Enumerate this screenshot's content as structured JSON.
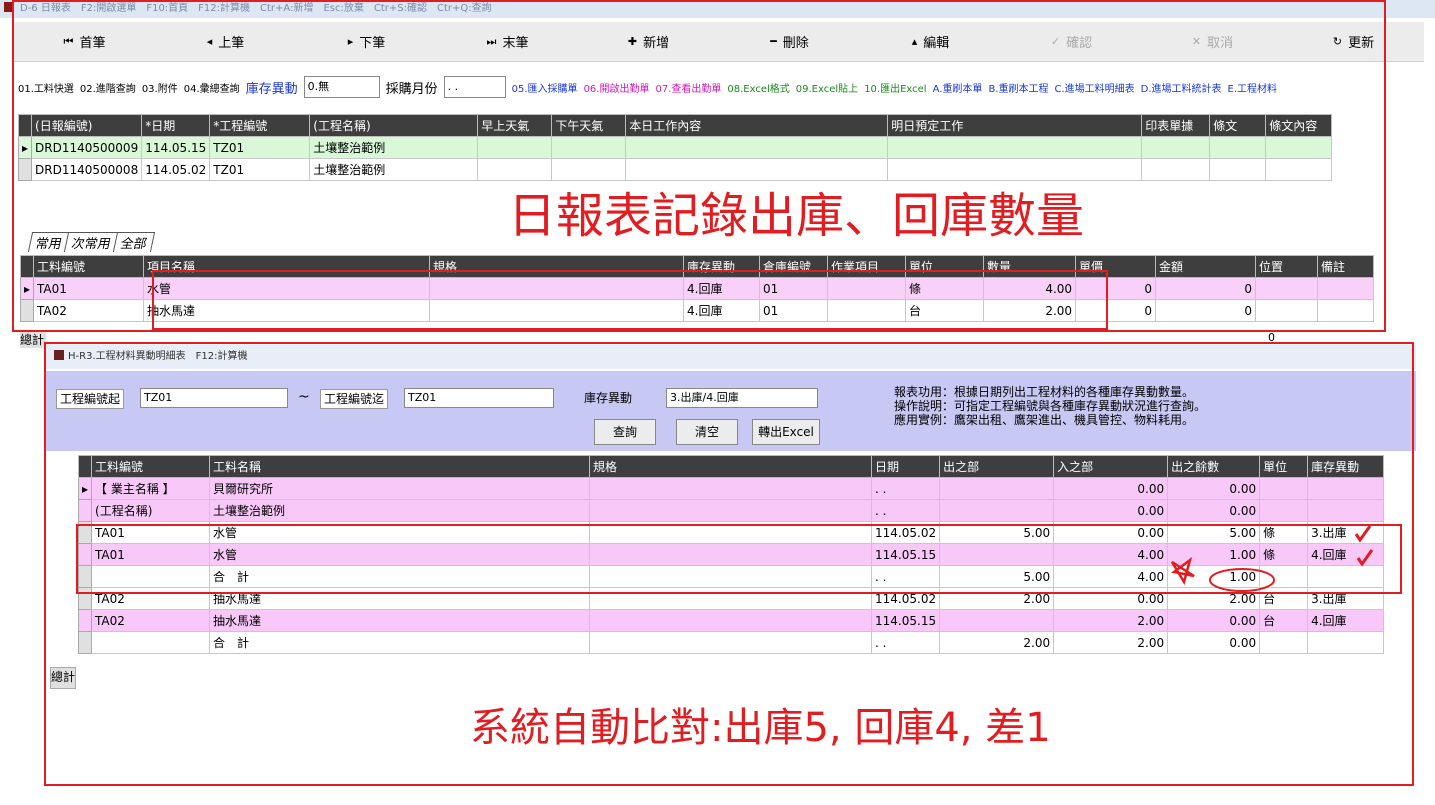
{
  "window": {
    "title": "D-6 日報表　F2:開啟選單　F10:首頁　F12:計算機　Ctr+A:新增　Esc:放棄　Ctr+S:確認　Ctr+Q:查詢"
  },
  "toolbar": [
    {
      "icon": "first-icon",
      "glyph": "⏮",
      "label": "首筆",
      "enabled": true
    },
    {
      "icon": "prev-icon",
      "glyph": "◂",
      "label": "上筆",
      "enabled": true
    },
    {
      "icon": "next-icon",
      "glyph": "▸",
      "label": "下筆",
      "enabled": true
    },
    {
      "icon": "last-icon",
      "glyph": "⏭",
      "label": "末筆",
      "enabled": true
    },
    {
      "icon": "plus-icon",
      "glyph": "✚",
      "label": "新增",
      "enabled": true
    },
    {
      "icon": "minus-icon",
      "glyph": "━",
      "label": "刪除",
      "enabled": true
    },
    {
      "icon": "up-icon",
      "glyph": "▴",
      "label": "編輯",
      "enabled": true
    },
    {
      "icon": "check-icon",
      "glyph": "✓",
      "label": "確認",
      "enabled": false
    },
    {
      "icon": "close-icon",
      "glyph": "✕",
      "label": "取消",
      "enabled": false
    },
    {
      "icon": "refresh-icon",
      "glyph": "↻",
      "label": "更新",
      "enabled": true
    }
  ],
  "query": {
    "links": [
      "01.工料快選",
      "02.進階查詢",
      "03.附件",
      "04.彙總查詢"
    ],
    "stock_label": "庫存異動",
    "stock_value": "0.無",
    "purchase_label": "採購月份",
    "purchase_value": ". .",
    "blue_links": [
      "05.匯入採購單"
    ],
    "magenta_links": [
      "06.開啟出勤單",
      "07.查看出勤單"
    ],
    "green_links": [
      "08.Excel格式",
      "09.Excel貼上",
      "10.匯出Excel"
    ],
    "blue_links2": [
      "A.重刷本單",
      "B.重刷本工程",
      "C.進場工料明細表",
      "D.進場工料統計表",
      "E.工程材料"
    ]
  },
  "report_grid": {
    "headers": [
      "(日報編號)",
      "*日期",
      "*工程編號",
      "(工程名稱)",
      "早上天氣",
      "下午天氣",
      "本日工作內容",
      "明日預定工作",
      "印表單據",
      "條文",
      "條文內容"
    ],
    "rows": [
      [
        "DRD1140500009",
        "114.05.15",
        "TZ01",
        "土壤整治範例",
        "",
        "",
        "",
        "",
        "",
        "",
        ""
      ],
      [
        "DRD1140500008",
        "114.05.02",
        "TZ01",
        "土壤整治範例",
        "",
        "",
        "",
        "",
        "",
        "",
        ""
      ]
    ]
  },
  "annotation_top": "日報表記錄出庫、回庫數量",
  "tabs": [
    "常用",
    "次常用",
    "全部"
  ],
  "item_grid": {
    "headers": [
      "工料編號",
      "項目名稱",
      "規格",
      "庫存異動",
      "倉庫編號",
      "作業項目",
      "單位",
      "數量",
      "單價",
      "金額",
      "位置",
      "備註"
    ],
    "rows": [
      [
        "TA01",
        "水管",
        "",
        "4.回庫",
        "01",
        "",
        "條",
        "4.00",
        "0",
        "0",
        "",
        ""
      ],
      [
        "TA02",
        "抽水馬達",
        "",
        "4.回庫",
        "01",
        "",
        "台",
        "2.00",
        "0",
        "0",
        "",
        ""
      ]
    ],
    "total_label": "總計",
    "total_amount": "0"
  },
  "inner_window": {
    "title": "H-R3.工程材料異動明細表　F12:計算機",
    "from_label": "工程編號起",
    "from_value": "TZ01",
    "tilde": "~",
    "to_label": "工程編號迄",
    "to_value": "TZ01",
    "stock_label": "庫存異動",
    "stock_value": "3.出庫/4.回庫",
    "buttons": [
      "查詢",
      "清空",
      "轉出Excel"
    ],
    "help": [
      "報表功用：根據日期列出工程材料的各種庫存異動數量。",
      "操作說明：可指定工程編號與各種庫存異動狀況進行查詢。",
      "應用實例：鷹架出租、鷹架進出、機具管控、物料耗用。"
    ]
  },
  "detail_grid": {
    "headers": [
      "工料編號",
      "工料名稱",
      "規格",
      "日期",
      "出之部",
      "入之部",
      "出之餘數",
      "單位",
      "庫存異動"
    ],
    "rows": [
      [
        "【 業主名稱 】",
        "貝爾研究所",
        "",
        ". .",
        "",
        "0.00",
        "0.00",
        "",
        ""
      ],
      [
        "(工程名稱)",
        "土壤整治範例",
        "",
        ". .",
        "",
        "0.00",
        "0.00",
        "",
        ""
      ],
      [
        "TA01",
        "水管",
        "",
        "114.05.02",
        "5.00",
        "0.00",
        "5.00",
        "條",
        "3.出庫"
      ],
      [
        "TA01",
        "水管",
        "",
        "114.05.15",
        "",
        "4.00",
        "1.00",
        "條",
        "4.回庫"
      ],
      [
        "",
        "合　計",
        "",
        ". .",
        "5.00",
        "4.00",
        "1.00",
        "",
        ""
      ],
      [
        "TA02",
        "抽水馬達",
        "",
        "114.05.02",
        "2.00",
        "0.00",
        "2.00",
        "台",
        "3.出庫"
      ],
      [
        "TA02",
        "抽水馬達",
        "",
        "114.05.15",
        "",
        "2.00",
        "0.00",
        "台",
        "4.回庫"
      ],
      [
        "",
        "合　計",
        "",
        ". .",
        "2.00",
        "2.00",
        "0.00",
        "",
        ""
      ]
    ],
    "total_label": "總計"
  },
  "annotation_bottom": "系統自動比對:出庫5,  回庫4,  差1",
  "colors": {
    "annotation": "#e21d22",
    "pink_row": "#f8d0f8",
    "green_row": "#d8f8d8",
    "form_bg": "#c8c8f4"
  }
}
